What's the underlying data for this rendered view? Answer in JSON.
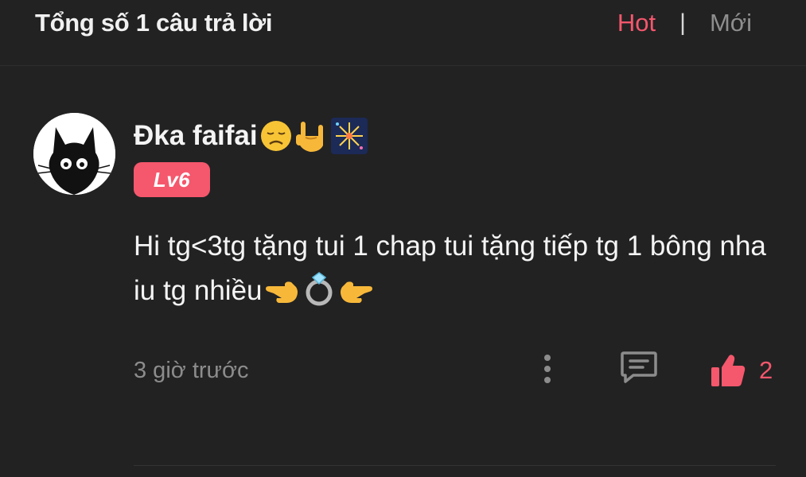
{
  "header": {
    "title": "Tổng số 1 câu trả lời",
    "sort_hot": "Hot",
    "sort_separator": "|",
    "sort_new": "Mới"
  },
  "comment": {
    "username": "Đka faifai",
    "username_emojis": [
      "disappointed-face-emoji",
      "love-you-gesture-emoji",
      "fireworks-emoji"
    ],
    "level_badge": "Lv6",
    "text_part1": "Hi tg<3tg tặng tui 1 chap tui tặng tiếp tg 1 bông nha iu tg nhiều",
    "text_emojis": [
      "pointing-left-emoji",
      "ring-emoji",
      "pointing-right-emoji"
    ],
    "timestamp": "3 giờ trước",
    "like_count": "2"
  },
  "colors": {
    "accent": "#f5576c",
    "background": "#222223",
    "muted_text": "#8c8c8c"
  },
  "icons": {
    "more": "more-vertical-icon",
    "reply": "comment-icon",
    "like": "thumbs-up-icon"
  }
}
